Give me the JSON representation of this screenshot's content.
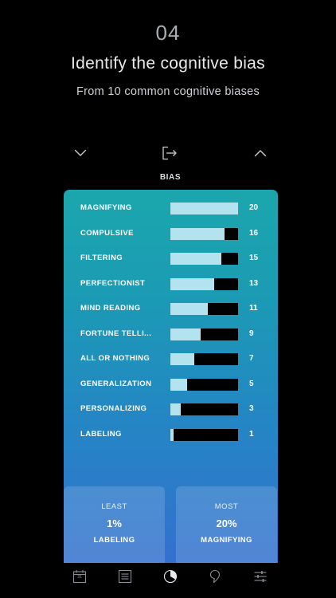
{
  "header": {
    "step": "04",
    "title": "Identify the cognitive bias",
    "subtitle": "From 10 common cognitive biases"
  },
  "controls": {
    "collapse_icon": "chevron-down-icon",
    "export_icon": "export-icon",
    "expand_icon": "chevron-up-icon"
  },
  "section_label": "BIAS",
  "colors": {
    "background": "#000000",
    "panel_top": "#1ba7ad",
    "panel_bottom": "#3470cf",
    "bar_fill": "#b2e3ee",
    "bar_track": "#000000"
  },
  "bias_scale_max": 20,
  "biases": [
    {
      "name": "MAGNIFYING",
      "count": "20",
      "value": 20
    },
    {
      "name": "COMPULSIVE",
      "count": "16",
      "value": 16
    },
    {
      "name": "FILTERING",
      "count": "15",
      "value": 15
    },
    {
      "name": "PERFECTIONIST",
      "count": "13",
      "value": 13
    },
    {
      "name": "MIND READING",
      "count": "11",
      "value": 11
    },
    {
      "name": "FORTUNE TELLI...",
      "count": "9",
      "value": 9
    },
    {
      "name": "ALL OR NOTHING",
      "count": "7",
      "value": 7
    },
    {
      "name": "GENERALIZATION",
      "count": "5",
      "value": 5
    },
    {
      "name": "PERSONALIZING",
      "count": "3",
      "value": 3
    },
    {
      "name": "LABELING",
      "count": "1",
      "value": 1
    }
  ],
  "summary": {
    "least": {
      "title": "LEAST",
      "value": "1%",
      "caption": "LABELING"
    },
    "most": {
      "title": "MOST",
      "value": "20%",
      "caption": "MAGNIFYING"
    }
  },
  "tabbar": {
    "calendar_day": "31",
    "items": [
      {
        "icon": "calendar-icon"
      },
      {
        "icon": "list-icon"
      },
      {
        "icon": "pie-chart-icon",
        "active": true
      },
      {
        "icon": "thought-bubble-icon"
      },
      {
        "icon": "settings-sliders-icon"
      }
    ]
  }
}
